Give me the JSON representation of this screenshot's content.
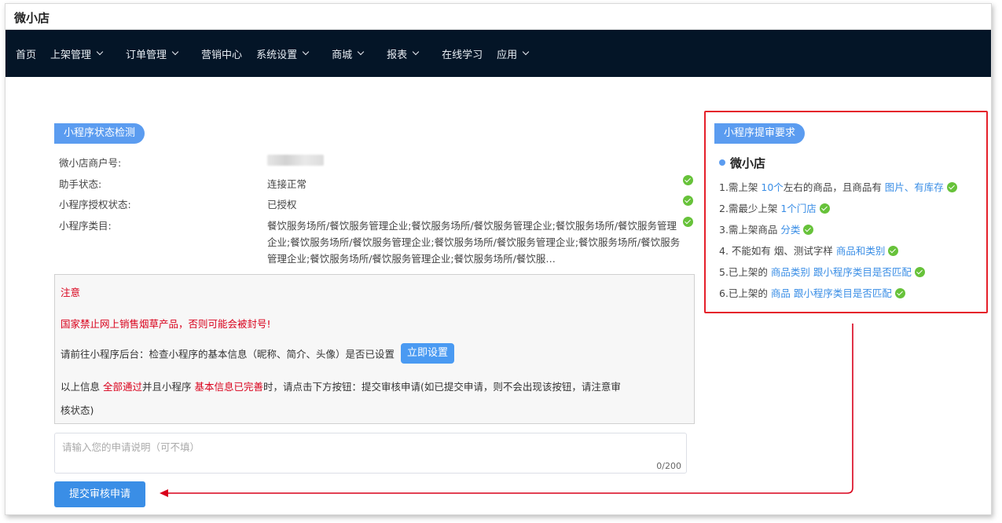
{
  "app_title": "微小店",
  "nav": [
    {
      "label": "首页",
      "dropdown": false
    },
    {
      "label": "上架管理",
      "dropdown": true
    },
    {
      "label": "订单管理",
      "dropdown": true
    },
    {
      "label": "营销中心",
      "dropdown": false
    },
    {
      "label": "系统设置",
      "dropdown": true
    },
    {
      "label": "商城",
      "dropdown": true
    },
    {
      "label": "报表",
      "dropdown": true
    },
    {
      "label": "在线学习",
      "dropdown": false
    },
    {
      "label": "应用",
      "dropdown": true
    }
  ],
  "status": {
    "header": "小程序状态检测",
    "rows": [
      {
        "label": "微小店商户号:",
        "value": "",
        "checked": false
      },
      {
        "label": "助手状态:",
        "value": "连接正常",
        "checked": true
      },
      {
        "label": "小程序授权状态:",
        "value": "已授权",
        "checked": true
      },
      {
        "label": "小程序类目:",
        "value": "餐饮服务场所/餐饮服务管理企业;餐饮服务场所/餐饮服务管理企业;餐饮服务场所/餐饮服务管理企业;餐饮服务场所/餐饮服务管理企业;餐饮服务场所/餐饮服务管理企业;餐饮服务场所/餐饮服务管理企业;餐饮服务场所/餐饮服务管理企业;餐饮服务场所/餐饮服…",
        "checked": true
      }
    ]
  },
  "notice": {
    "title": "注意",
    "warning": "国家禁止网上销售烟草产品，否则可能会被封号!",
    "goto_text": "请前往小程序后台：检查小程序的基本信息（昵称、简介、头像）是否已设置",
    "set_button": "立即设置",
    "line3_a": "以上信息 ",
    "line3_b": "全部通过",
    "line3_c": "并且小程序 ",
    "line3_d": "基本信息已完善",
    "line3_e": "时，请点击下方按钮：提交审核申请(如已提交申请，则不会出现该按钮，请注意审",
    "line4": "核状态)"
  },
  "apply": {
    "placeholder": "请输入您的申请说明（可不填）",
    "counter": "0/200",
    "submit_label": "提交审核申请"
  },
  "requirements": {
    "header": "小程序提审要求",
    "shop_name": "微小店",
    "items": [
      {
        "parts": [
          "1.需上架 ",
          "10个",
          "左右的商品，且商品有 ",
          "图片、有库存"
        ]
      },
      {
        "parts": [
          "2.需最少上架 ",
          "1个门店"
        ]
      },
      {
        "parts": [
          "3.需上架商品 ",
          "分类"
        ]
      },
      {
        "parts": [
          "4. 不能如有 烟、测试字样 ",
          "商品和类别"
        ]
      },
      {
        "parts": [
          "5.已上架的 ",
          "商品类别 跟小程序类目是否匹配"
        ]
      },
      {
        "parts": [
          "6.已上架的 ",
          "商品 跟小程序类目是否匹配"
        ]
      }
    ]
  },
  "colors": {
    "nav_bg": "#041527",
    "accent": "#3a8ee6",
    "success": "#67c23a",
    "danger": "#d9001b",
    "highlight_box": "#e5202a"
  }
}
